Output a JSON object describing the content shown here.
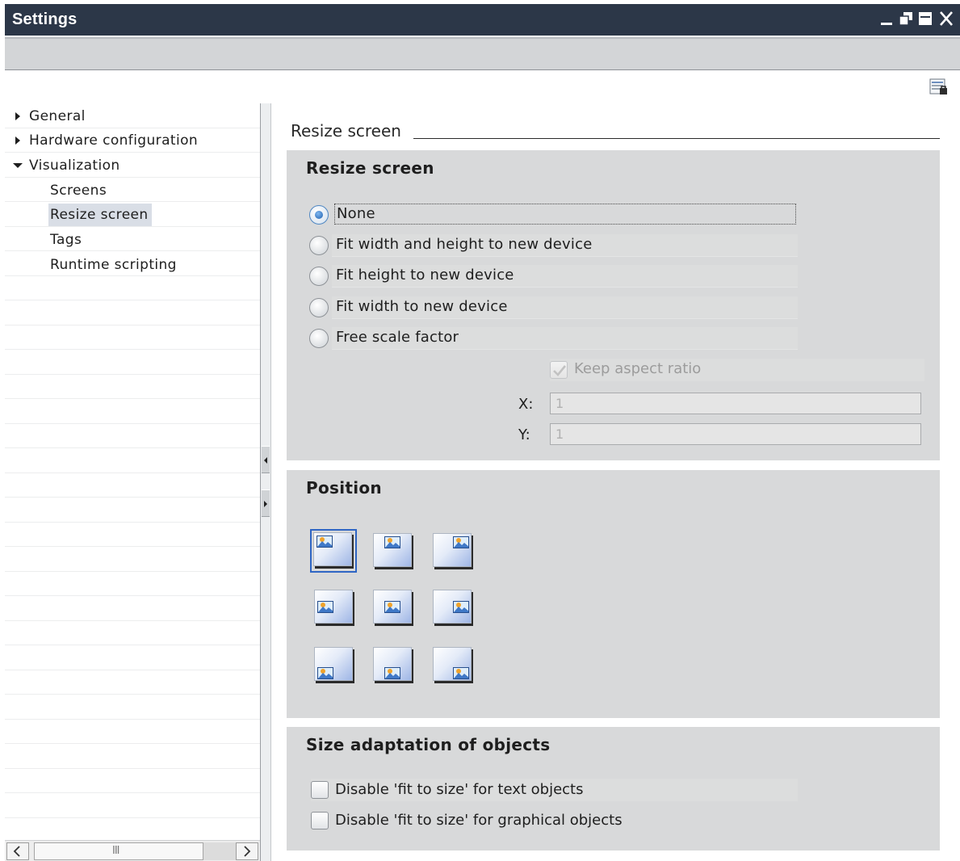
{
  "window": {
    "title": "Settings",
    "controls": [
      "minimize-icon",
      "restore-icon",
      "maximize-icon",
      "close-icon"
    ]
  },
  "nav": {
    "items": [
      {
        "label": "General",
        "level": 0,
        "expanded": false
      },
      {
        "label": "Hardware configuration",
        "level": 0,
        "expanded": false
      },
      {
        "label": "Visualization",
        "level": 0,
        "expanded": true
      },
      {
        "label": "Screens",
        "level": 1
      },
      {
        "label": "Resize screen",
        "level": 1,
        "selected": true
      },
      {
        "label": "Tags",
        "level": 1
      },
      {
        "label": "Runtime scripting",
        "level": 1
      }
    ],
    "scrollbar": {
      "grip": "III"
    }
  },
  "page": {
    "title": "Resize screen"
  },
  "resize": {
    "title": "Resize screen",
    "options": [
      {
        "label": "None",
        "checked": true
      },
      {
        "label": "Fit width and height to new device",
        "checked": false
      },
      {
        "label": "Fit height to new device",
        "checked": false
      },
      {
        "label": "Fit width to new device",
        "checked": false
      },
      {
        "label": "Free scale factor",
        "checked": false
      }
    ],
    "keep_aspect_label": "Keep aspect ratio",
    "keep_aspect_checked": true,
    "x_label": "X:",
    "x_value": "1",
    "y_label": "Y:",
    "y_value": "1"
  },
  "position": {
    "title": "Position",
    "grid": [
      [
        "top-left",
        "top-center",
        "top-right"
      ],
      [
        "middle-left",
        "center",
        "middle-right"
      ],
      [
        "bottom-left",
        "bottom-center",
        "bottom-right"
      ]
    ],
    "selected": "top-left"
  },
  "size_adaptation": {
    "title": "Size adaptation of objects",
    "options": [
      {
        "label": "Disable 'fit to size' for text objects",
        "checked": false
      },
      {
        "label": "Disable 'fit to size' for graphical objects",
        "checked": false
      }
    ]
  },
  "colors": {
    "titlebar": "#2c3748",
    "section_bg": "#d8d9da",
    "selected_nav": "#d9dee6",
    "selection_border": "#2f66c4"
  }
}
